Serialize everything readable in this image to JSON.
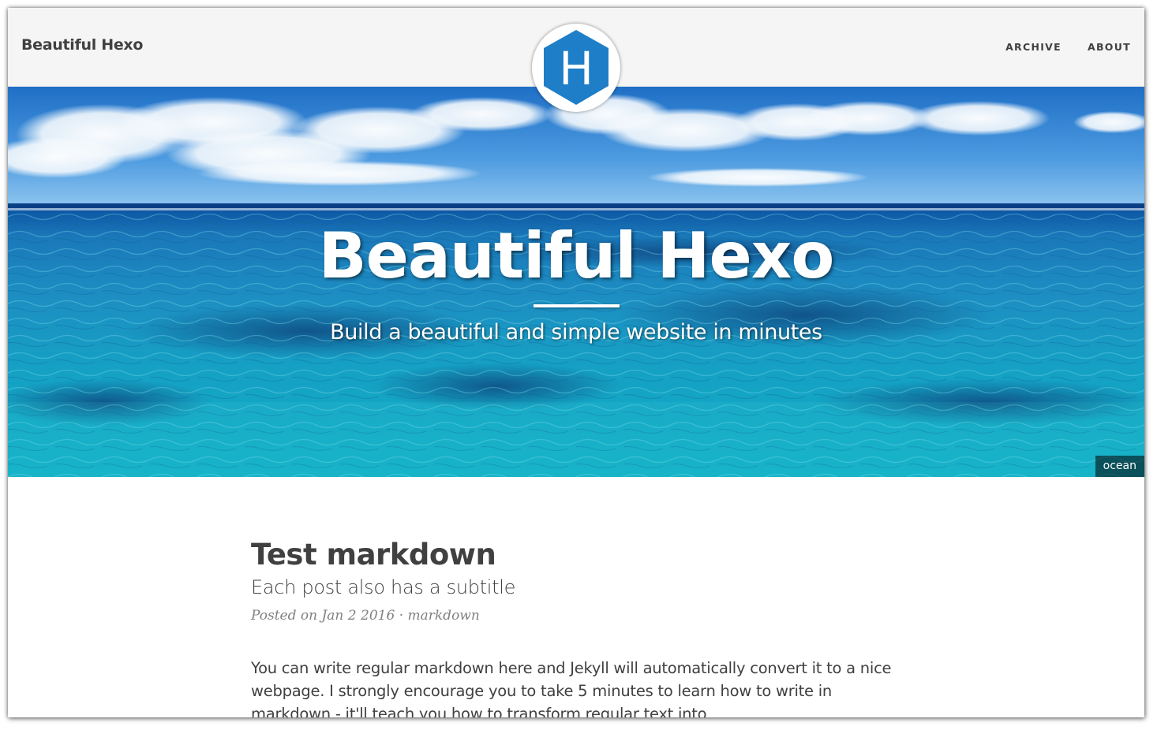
{
  "navbar": {
    "brand": "Beautiful Hexo",
    "links": [
      {
        "label": "ARCHIVE"
      },
      {
        "label": "ABOUT"
      }
    ],
    "avatar_letter": "H",
    "avatar_color": "#1e7ec8"
  },
  "hero": {
    "title": "Beautiful Hexo",
    "subtitle": "Build a beautiful and simple website in minutes",
    "image_caption": "ocean"
  },
  "post": {
    "title": "Test markdown",
    "subtitle": "Each post also has a subtitle",
    "meta_prefix": "Posted on",
    "date": "Jan 2 2016",
    "separator": "·",
    "tag": "markdown",
    "excerpt": "You can write regular markdown here and Jekyll will automatically convert it to a nice webpage. I strongly encourage you to take 5 minutes to learn how to write in markdown - it'll teach you how to transform regular text into bold/italics/headings/tables/etc."
  },
  "colors": {
    "navbar_bg": "#f5f5f5",
    "text": "#404040",
    "meta": "#808080",
    "sky": "#3a8fd8",
    "ocean": "#17a3c6"
  }
}
